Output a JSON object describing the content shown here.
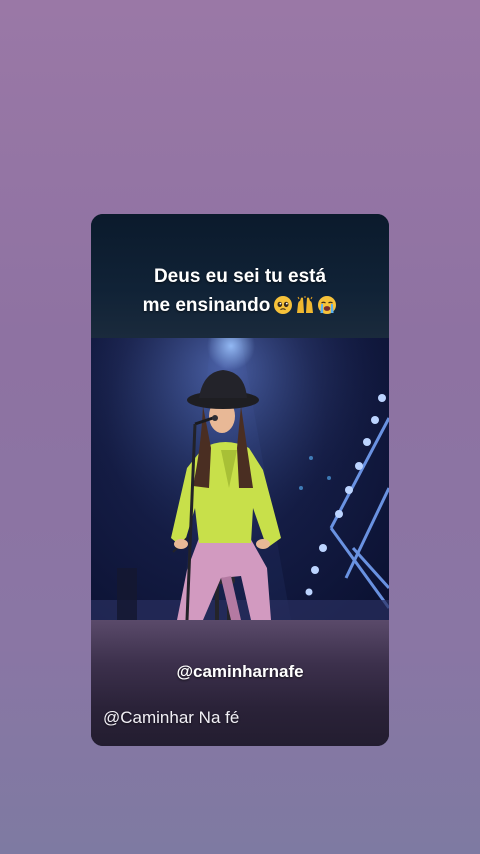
{
  "caption": {
    "line1": "Deus eu sei tu está",
    "line2": "me ensinando",
    "emojis": [
      "pleading-face-icon",
      "raised-hands-icon",
      "loudly-crying-face-icon"
    ]
  },
  "overlay_handle": "@caminharnafe",
  "watermark": "@Caminhar Na fé",
  "colors": {
    "background_top": "#9a78a6",
    "background_bottom": "#7e7aa2",
    "shirt": "#c8e04a",
    "pants": "#d49ac0",
    "stage_light": "#6aa0ff"
  }
}
